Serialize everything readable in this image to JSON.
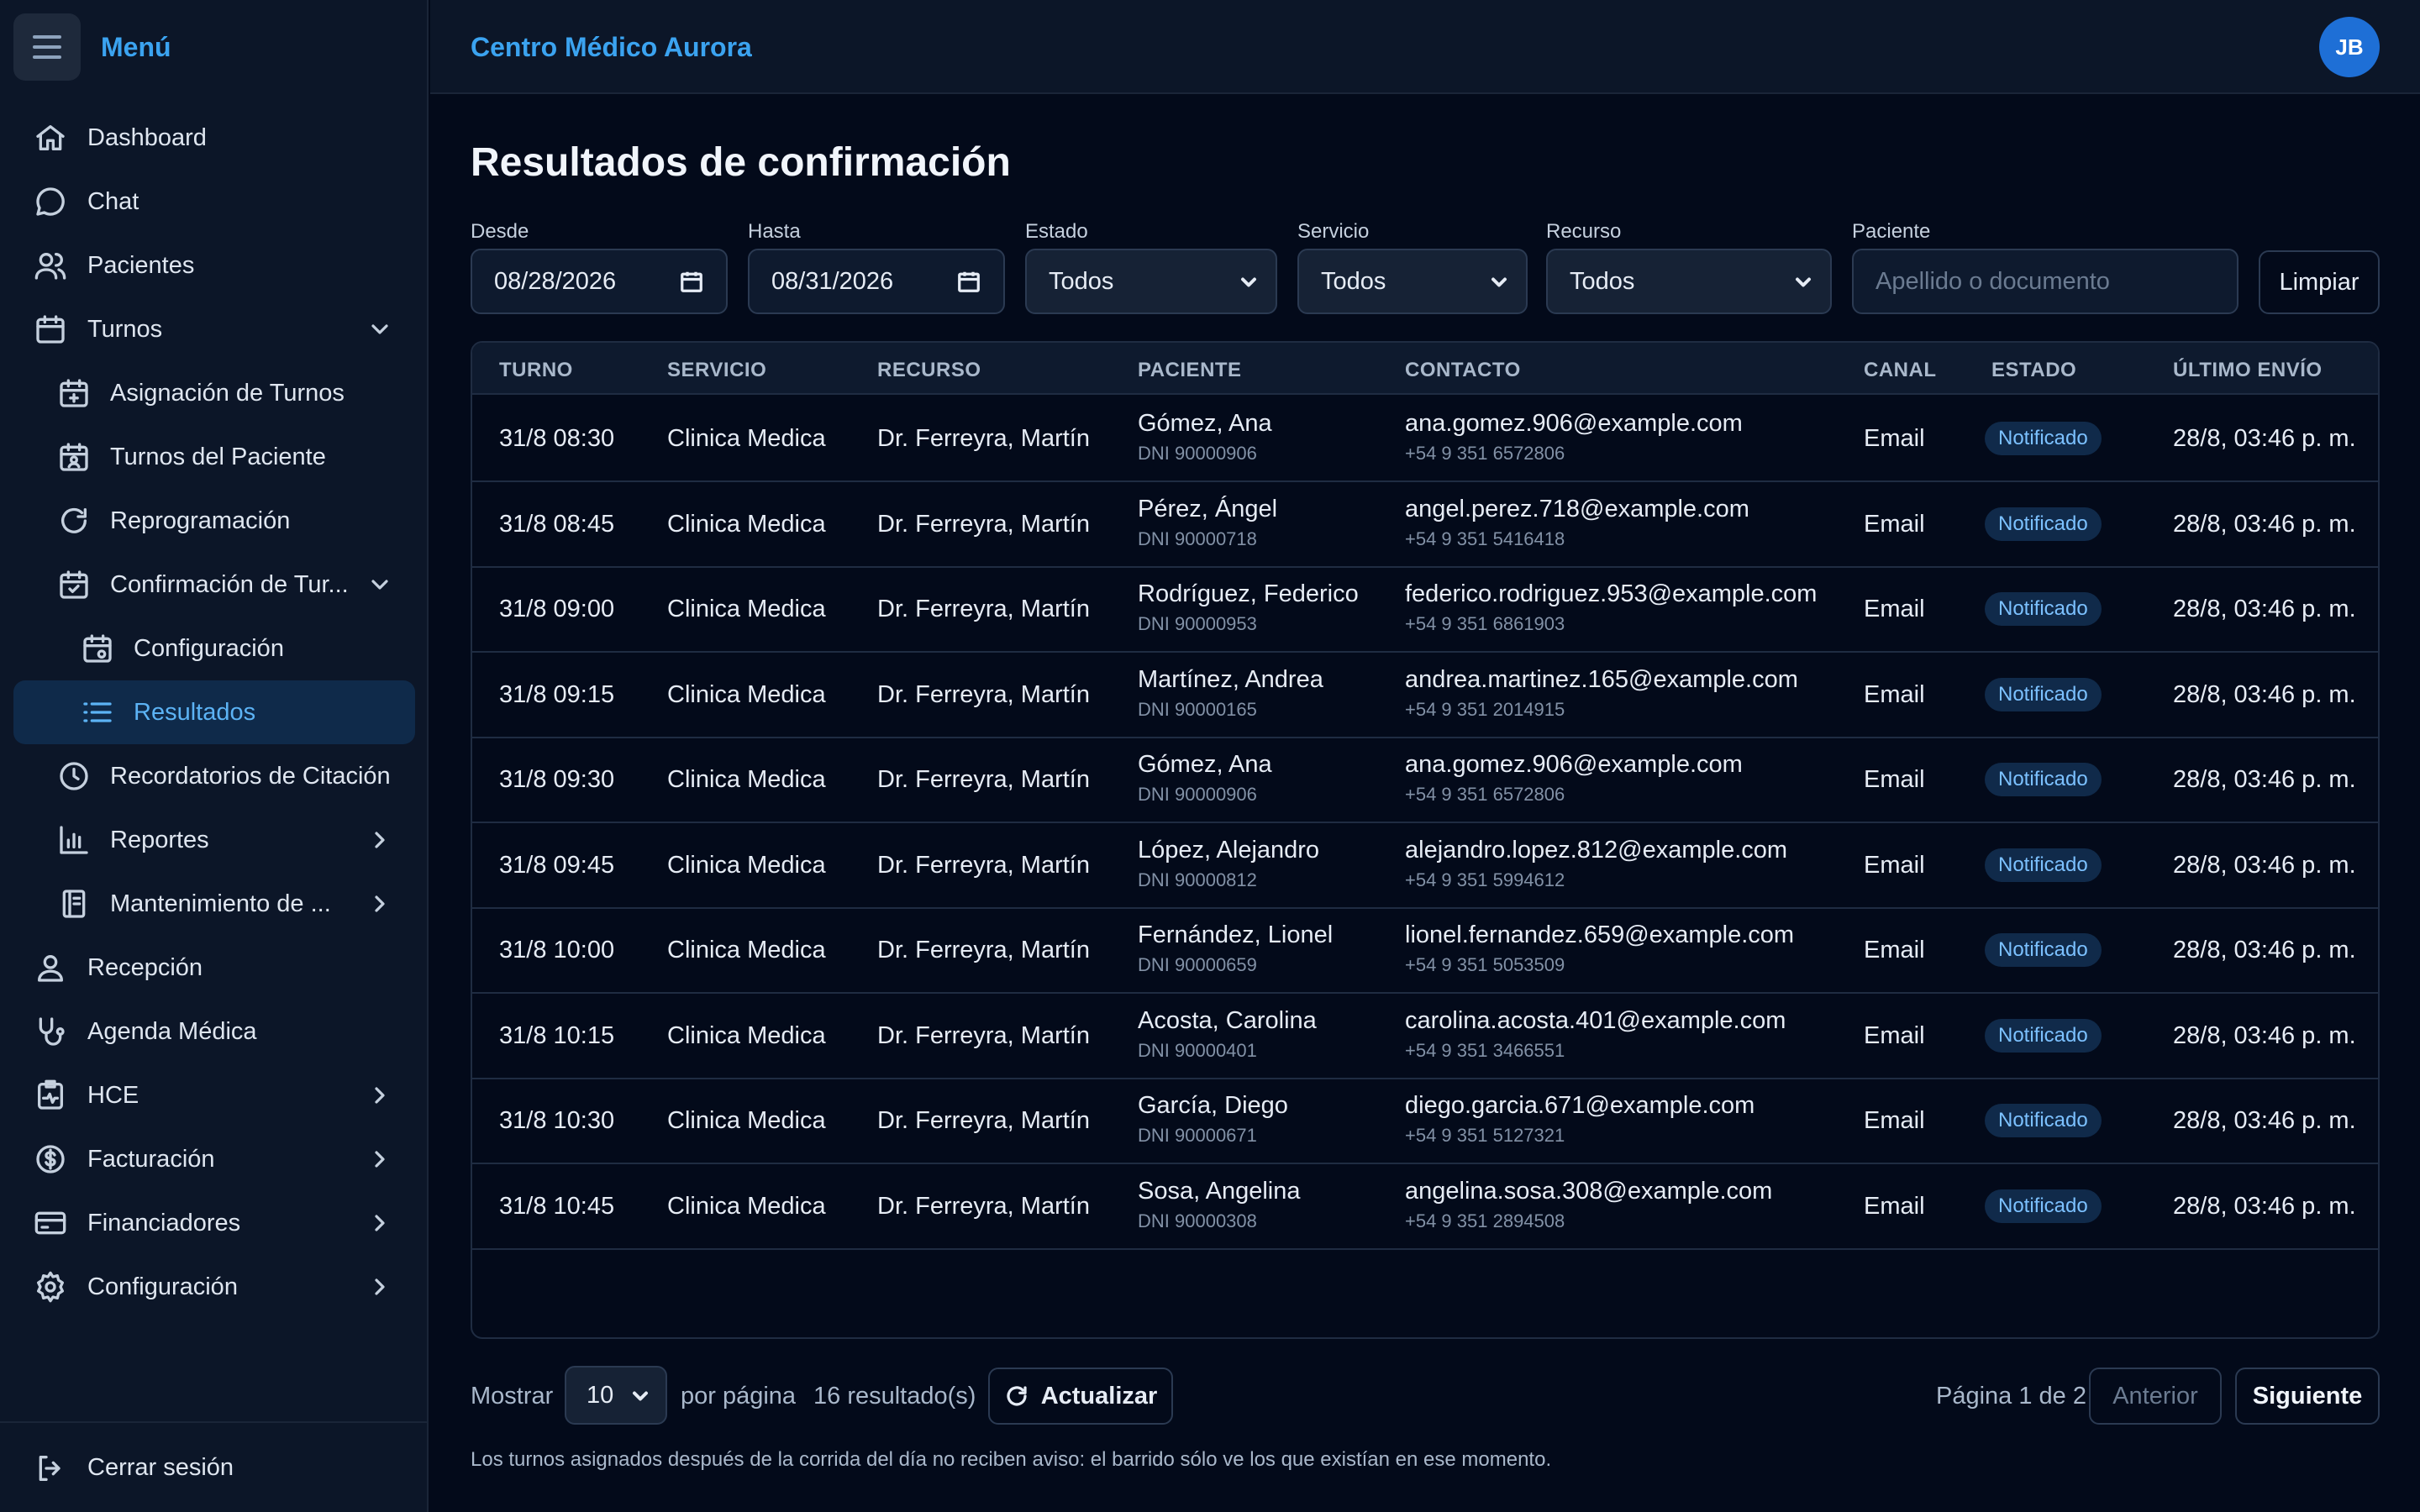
{
  "sidebar": {
    "title": "Menú",
    "items": [
      {
        "label": "Dashboard",
        "icon": "home-icon"
      },
      {
        "label": "Chat",
        "icon": "chat-icon"
      },
      {
        "label": "Pacientes",
        "icon": "users-icon"
      },
      {
        "label": "Turnos",
        "icon": "calendar-icon"
      },
      {
        "label": "Asignación de Turnos",
        "icon": "calendar-plus-icon"
      },
      {
        "label": "Turnos del Paciente",
        "icon": "calendar-user-icon"
      },
      {
        "label": "Reprogramación",
        "icon": "refresh-icon"
      },
      {
        "label": "Confirmación de Tur...",
        "icon": "calendar-check-icon"
      },
      {
        "label": "Configuración",
        "icon": "calendar-gear-icon"
      },
      {
        "label": "Resultados",
        "icon": "list-icon"
      },
      {
        "label": "Recordatorios de Citación",
        "icon": "clock-icon"
      },
      {
        "label": "Reportes",
        "icon": "bar-chart-icon"
      },
      {
        "label": "Mantenimiento de ...",
        "icon": "book-icon"
      },
      {
        "label": "Recepción",
        "icon": "person-icon"
      },
      {
        "label": "Agenda Médica",
        "icon": "stethoscope-icon"
      },
      {
        "label": "HCE",
        "icon": "clipboard-pulse-icon"
      },
      {
        "label": "Facturación",
        "icon": "dollar-icon"
      },
      {
        "label": "Financiadores",
        "icon": "credit-card-icon"
      },
      {
        "label": "Configuración",
        "icon": "gear-icon"
      }
    ],
    "logout": "Cerrar sesión"
  },
  "header": {
    "brand": "Centro Médico Aurora",
    "avatar": "JB"
  },
  "page": {
    "title": "Resultados de confirmación"
  },
  "filters": {
    "desde_label": "Desde",
    "desde_value": "08/28/2026",
    "hasta_label": "Hasta",
    "hasta_value": "08/31/2026",
    "estado_label": "Estado",
    "estado_value": "Todos",
    "servicio_label": "Servicio",
    "servicio_value": "Todos",
    "recurso_label": "Recurso",
    "recurso_value": "Todos",
    "paciente_label": "Paciente",
    "paciente_placeholder": "Apellido o documento",
    "clear": "Limpiar"
  },
  "table": {
    "headers": [
      "TURNO",
      "SERVICIO",
      "RECURSO",
      "PACIENTE",
      "CONTACTO",
      "CANAL",
      "ESTADO",
      "ÚLTIMO ENVÍO"
    ],
    "rows": [
      {
        "turno": "31/8 08:30",
        "servicio": "Clinica Medica",
        "recurso": "Dr. Ferreyra, Martín",
        "paciente": "Gómez, Ana",
        "dni": "DNI 90000906",
        "email": "ana.gomez.906@example.com",
        "tel": "+54 9 351 6572806",
        "canal": "Email",
        "estado": "Notificado",
        "envio": "28/8, 03:46 p. m."
      },
      {
        "turno": "31/8 08:45",
        "servicio": "Clinica Medica",
        "recurso": "Dr. Ferreyra, Martín",
        "paciente": "Pérez, Ángel",
        "dni": "DNI 90000718",
        "email": "angel.perez.718@example.com",
        "tel": "+54 9 351 5416418",
        "canal": "Email",
        "estado": "Notificado",
        "envio": "28/8, 03:46 p. m."
      },
      {
        "turno": "31/8 09:00",
        "servicio": "Clinica Medica",
        "recurso": "Dr. Ferreyra, Martín",
        "paciente": "Rodríguez, Federico",
        "dni": "DNI 90000953",
        "email": "federico.rodriguez.953@example.com",
        "tel": "+54 9 351 6861903",
        "canal": "Email",
        "estado": "Notificado",
        "envio": "28/8, 03:46 p. m."
      },
      {
        "turno": "31/8 09:15",
        "servicio": "Clinica Medica",
        "recurso": "Dr. Ferreyra, Martín",
        "paciente": "Martínez, Andrea",
        "dni": "DNI 90000165",
        "email": "andrea.martinez.165@example.com",
        "tel": "+54 9 351 2014915",
        "canal": "Email",
        "estado": "Notificado",
        "envio": "28/8, 03:46 p. m."
      },
      {
        "turno": "31/8 09:30",
        "servicio": "Clinica Medica",
        "recurso": "Dr. Ferreyra, Martín",
        "paciente": "Gómez, Ana",
        "dni": "DNI 90000906",
        "email": "ana.gomez.906@example.com",
        "tel": "+54 9 351 6572806",
        "canal": "Email",
        "estado": "Notificado",
        "envio": "28/8, 03:46 p. m."
      },
      {
        "turno": "31/8 09:45",
        "servicio": "Clinica Medica",
        "recurso": "Dr. Ferreyra, Martín",
        "paciente": "López, Alejandro",
        "dni": "DNI 90000812",
        "email": "alejandro.lopez.812@example.com",
        "tel": "+54 9 351 5994612",
        "canal": "Email",
        "estado": "Notificado",
        "envio": "28/8, 03:46 p. m."
      },
      {
        "turno": "31/8 10:00",
        "servicio": "Clinica Medica",
        "recurso": "Dr. Ferreyra, Martín",
        "paciente": "Fernández, Lionel",
        "dni": "DNI 90000659",
        "email": "lionel.fernandez.659@example.com",
        "tel": "+54 9 351 5053509",
        "canal": "Email",
        "estado": "Notificado",
        "envio": "28/8, 03:46 p. m."
      },
      {
        "turno": "31/8 10:15",
        "servicio": "Clinica Medica",
        "recurso": "Dr. Ferreyra, Martín",
        "paciente": "Acosta, Carolina",
        "dni": "DNI 90000401",
        "email": "carolina.acosta.401@example.com",
        "tel": "+54 9 351 3466551",
        "canal": "Email",
        "estado": "Notificado",
        "envio": "28/8, 03:46 p. m."
      },
      {
        "turno": "31/8 10:30",
        "servicio": "Clinica Medica",
        "recurso": "Dr. Ferreyra, Martín",
        "paciente": "García, Diego",
        "dni": "DNI 90000671",
        "email": "diego.garcia.671@example.com",
        "tel": "+54 9 351 5127321",
        "canal": "Email",
        "estado": "Notificado",
        "envio": "28/8, 03:46 p. m."
      },
      {
        "turno": "31/8 10:45",
        "servicio": "Clinica Medica",
        "recurso": "Dr. Ferreyra, Martín",
        "paciente": "Sosa, Angelina",
        "dni": "DNI 90000308",
        "email": "angelina.sosa.308@example.com",
        "tel": "+54 9 351 2894508",
        "canal": "Email",
        "estado": "Notificado",
        "envio": "28/8, 03:46 p. m."
      }
    ]
  },
  "footer": {
    "show_label": "Mostrar",
    "page_size": "10",
    "per_page": "por página",
    "results": "16 resultado(s)",
    "refresh": "Actualizar",
    "page_info": "Página 1 de 2",
    "prev": "Anterior",
    "next": "Siguiente",
    "note": "Los turnos asignados después de la corrida del día no reciben aviso: el barrido sólo ve los que existían en ese momento."
  },
  "colors": {
    "accent": "#3ba3f0",
    "badge_bg": "#102a4a",
    "badge_text": "#7cc1ff",
    "active_nav_bg": "#0f2a4a"
  }
}
